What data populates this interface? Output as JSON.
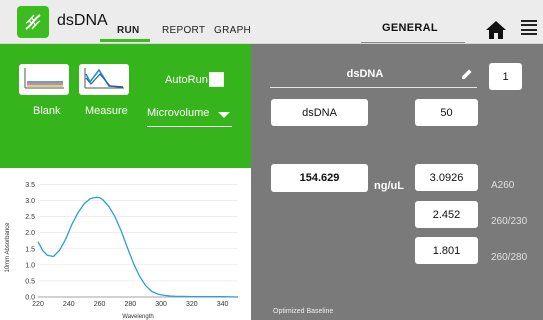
{
  "header": {
    "app_name": "dsDNA",
    "tabs": [
      {
        "label": "RUN",
        "active": true
      },
      {
        "label": "REPORT",
        "active": false
      },
      {
        "label": "GRAPH",
        "active": false
      }
    ],
    "section": "GENERAL",
    "accent_color": "#3cbd1f"
  },
  "controls": {
    "blank_label": "Blank",
    "measure_label": "Measure",
    "autorun_label": "AutoRun",
    "autorun_checked": false,
    "mode_select_value": "Microvolume"
  },
  "sample": {
    "name": "dsDNA",
    "number": "1",
    "type": "dsDNA",
    "factor": "50",
    "concentration": "154.629",
    "concentration_unit": "ng/uL",
    "a260_value": "3.0926",
    "a260_label": "A260",
    "ratio_260_230_value": "2.452",
    "ratio_260_230_label": "260/230",
    "ratio_260_280_value": "1.801",
    "ratio_260_280_label": "260/280",
    "baseline_note": "Optimized Baseline"
  },
  "chart_data": {
    "type": "line",
    "title": "",
    "xlabel": "Wavelength",
    "ylabel": "10mm Absorbance",
    "xlim": [
      220,
      350
    ],
    "ylim": [
      0,
      3.7
    ],
    "xticks": [
      220,
      240,
      260,
      280,
      300,
      320,
      340
    ],
    "yticks": [
      0.0,
      0.5,
      1.0,
      1.5,
      2.0,
      2.5,
      3.0,
      3.5
    ],
    "grid": true,
    "series": [
      {
        "color": "#2a9fd8",
        "x": [
          220,
          223,
          226,
          230,
          234,
          238,
          242,
          246,
          250,
          254,
          258,
          260,
          262,
          266,
          270,
          274,
          278,
          282,
          286,
          290,
          294,
          298,
          302,
          306,
          310,
          315,
          320,
          330,
          340,
          350
        ],
        "y": [
          1.72,
          1.45,
          1.3,
          1.26,
          1.45,
          1.8,
          2.25,
          2.62,
          2.9,
          3.06,
          3.1,
          3.09,
          3.03,
          2.82,
          2.5,
          2.06,
          1.55,
          1.05,
          0.65,
          0.35,
          0.17,
          0.09,
          0.05,
          0.03,
          0.02,
          0.02,
          0.01,
          0.01,
          0.01,
          0.0
        ]
      }
    ]
  }
}
